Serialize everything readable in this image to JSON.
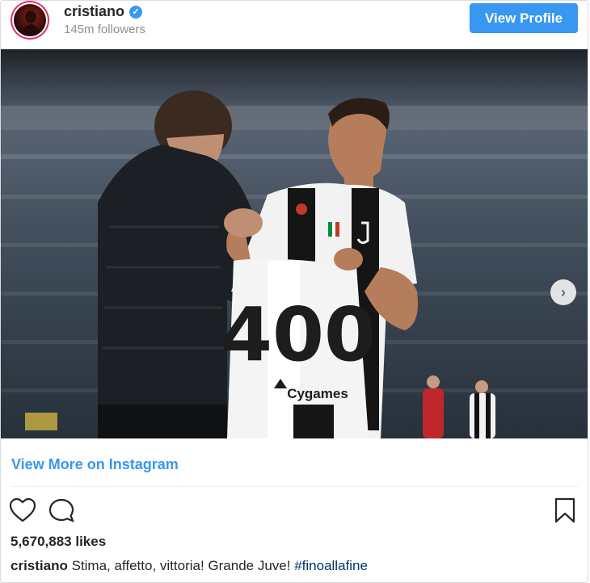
{
  "header": {
    "username": "cristiano",
    "verified_badge": "✓",
    "followers": "145m followers",
    "view_profile_label": "View Profile"
  },
  "post": {
    "photo_next_icon": "chevron-right-icon",
    "jersey_number": "400",
    "jersey_sponsor": "Cygames"
  },
  "view_more_label": "View More on Instagram",
  "actions": {
    "like_icon": "heart-icon",
    "comment_icon": "comment-icon",
    "save_icon": "bookmark-icon"
  },
  "likes": "5,670,883 likes",
  "caption": {
    "username": "cristiano",
    "text": "Stima, affetto, vittoria! Grande Juve!",
    "hashtag": "#finoallafine"
  },
  "colors": {
    "accent_blue": "#3897f0",
    "text_dark": "#262626",
    "text_muted": "#8e8e8e",
    "hashtag": "#003569"
  }
}
